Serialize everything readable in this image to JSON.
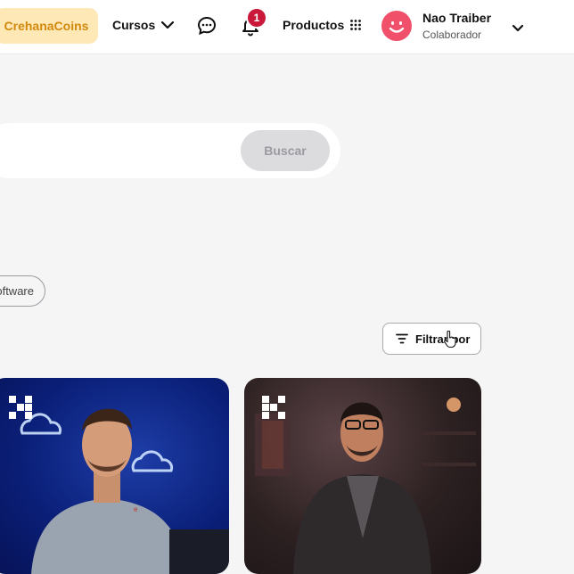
{
  "header": {
    "coins_label": "CrehanaCoins",
    "cursos_label": "Cursos",
    "productos_label": "Productos",
    "notifications_count": "1",
    "user": {
      "name": "Nao Traiber",
      "role": "Colaborador"
    }
  },
  "search": {
    "placeholder": "",
    "button_label": "Buscar"
  },
  "chips": [
    {
      "label": "Software"
    }
  ],
  "filter": {
    "button_label": "Filtrar por"
  },
  "course_cards": [
    {
      "brand_icon": "crehana-logo-icon",
      "image": "instructor-photo-blue-background"
    },
    {
      "brand_icon": "crehana-logo-icon",
      "image": "instructor-photo-dark-studio"
    }
  ],
  "colors": {
    "coins_bg": "#fde8b6",
    "coins_text": "#d4890d",
    "badge": "#c9183a",
    "avatar": "#f0506a",
    "search_button_bg": "#dcdcdf"
  }
}
